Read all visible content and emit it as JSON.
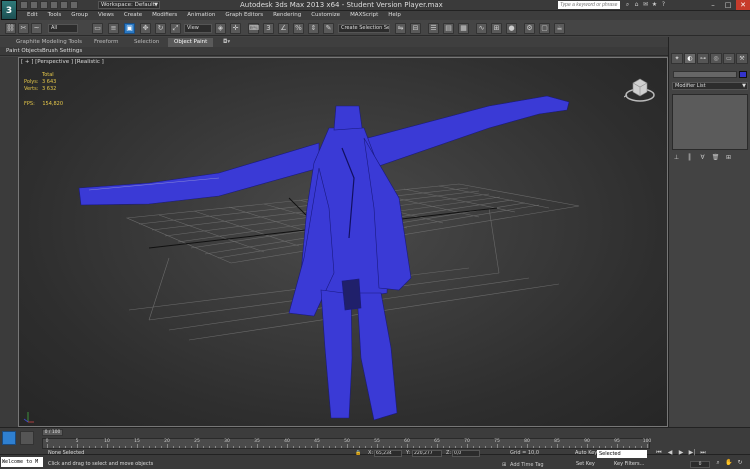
{
  "window": {
    "logo": "3",
    "workspace": "Workspace: Default",
    "title": "Autodesk 3ds Max  2013 x64  - Student Version   Player.max",
    "search_placeholder": "Type a keyword or phrase",
    "controls": {
      "minimize": "–",
      "maximize": "□",
      "close": "✕"
    }
  },
  "menu": [
    "Edit",
    "Tools",
    "Group",
    "Views",
    "Create",
    "Modifiers",
    "Animation",
    "Graph Editors",
    "Rendering",
    "Customize",
    "MAXScript",
    "Help"
  ],
  "toolbar": {
    "filter": "All",
    "ref_coord": "View",
    "named_selection": "Create Selection Se"
  },
  "ribbon": {
    "tabs": [
      "Graphite Modeling Tools",
      "Freeform",
      "Selection",
      "Object Paint"
    ],
    "active_tab": "Object Paint",
    "sub_buttons": [
      "Paint Objects",
      "Brush Settings"
    ]
  },
  "viewport": {
    "label": "[ + ] [Perspective ] [Realistic ]",
    "stats": {
      "header": "Total",
      "polys_label": "Polys:",
      "polys": "3 643",
      "verts_label": "Verts:",
      "verts": "3 632",
      "fps_label": "FPS:",
      "fps": "154,820"
    },
    "model_color": "#3a3ad6"
  },
  "command_panel": {
    "modifier_list": "Modifier List"
  },
  "timeline": {
    "frame_slider": "0 / 100",
    "ticks": [
      "0",
      "5",
      "10",
      "15",
      "20",
      "25",
      "30",
      "35",
      "40",
      "45",
      "50",
      "55",
      "60",
      "65",
      "70",
      "75",
      "80",
      "85",
      "90",
      "95",
      "100"
    ]
  },
  "status": {
    "maxscript": "Welcome to M",
    "selection": "None Selected",
    "prompt": "Click and drag to select and move objects",
    "x_label": "X:",
    "x": "65,234",
    "y_label": "Y:",
    "y": "220,277",
    "z_label": "Z:",
    "z": "0,0",
    "grid": "Grid = 10,0",
    "add_time_tag": "Add Time Tag",
    "auto_key": "Auto Key",
    "set_key": "Set Key",
    "selected": "Selected",
    "key_filters": "Key Filters...",
    "current_frame": "0"
  }
}
